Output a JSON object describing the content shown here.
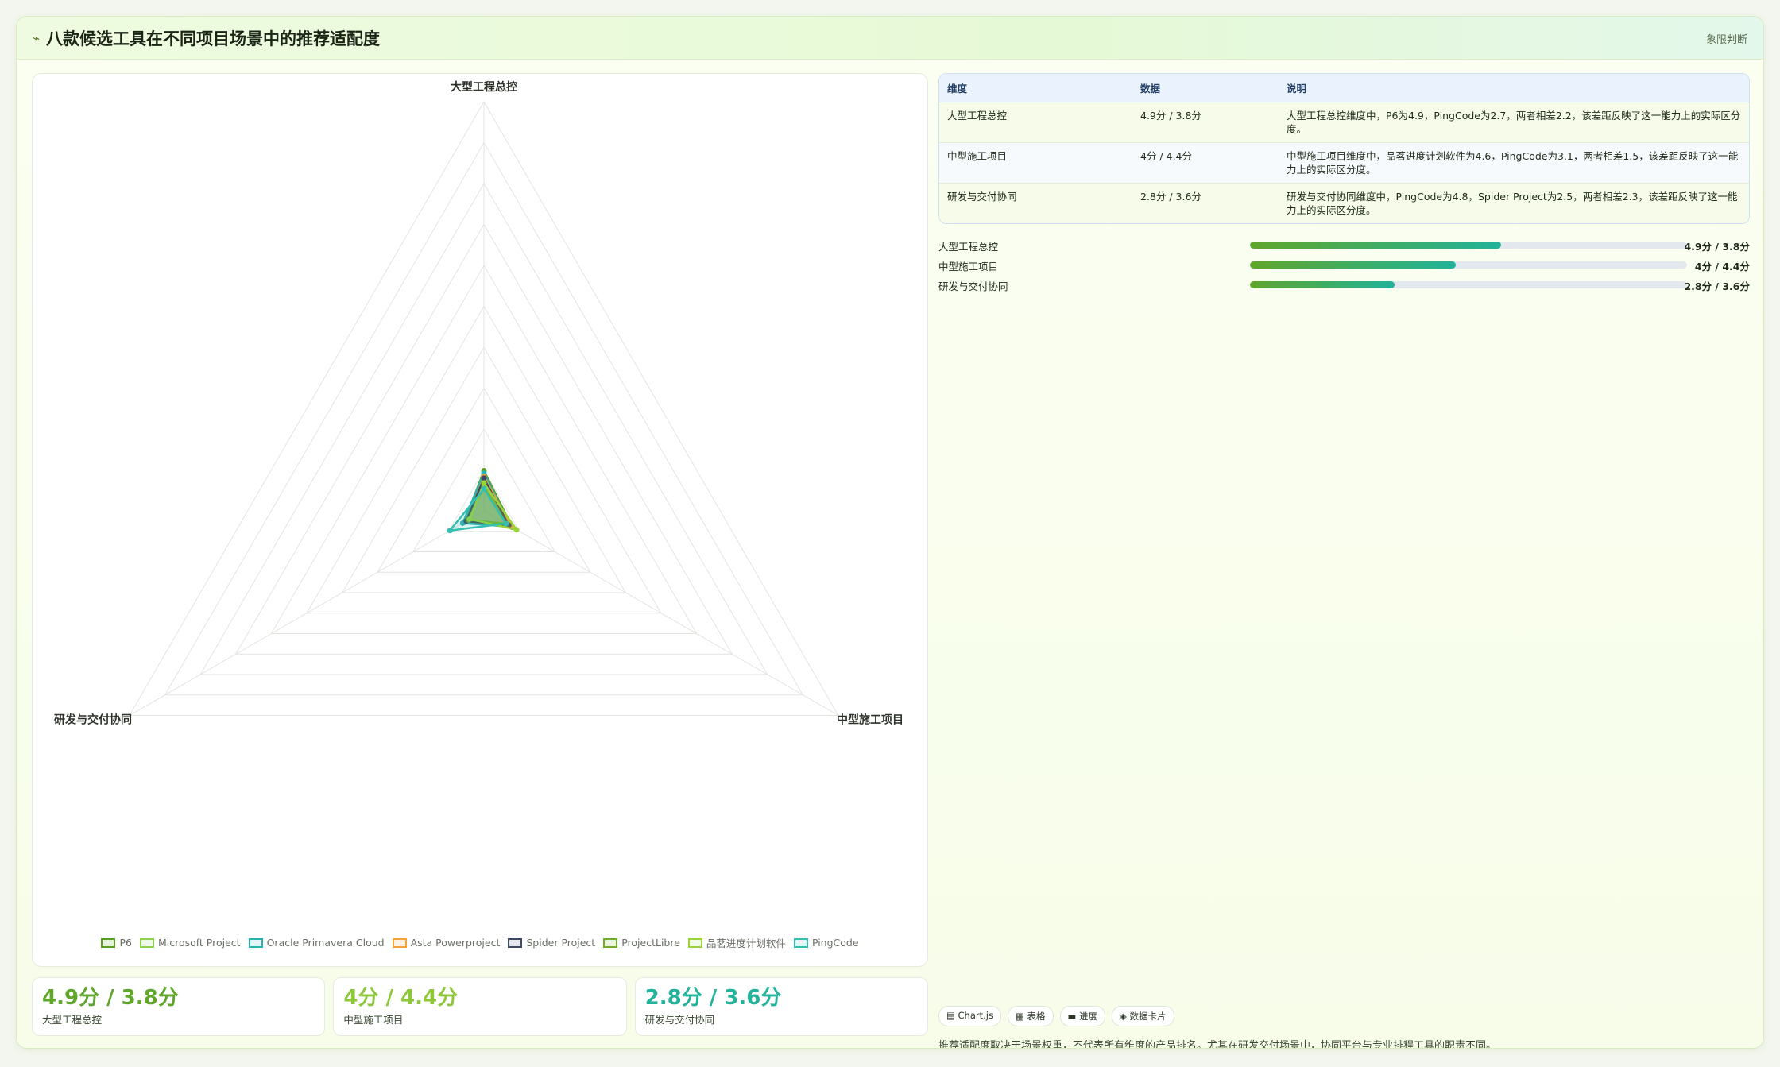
{
  "header": {
    "title": "八款候选工具在不同项目场景中的推荐适配度",
    "tag": "象限判断"
  },
  "chart_data": {
    "type": "radar",
    "axes": [
      "大型工程总控",
      "中型施工项目",
      "研发与交付协同"
    ],
    "rmax": 50,
    "series": [
      {
        "name": "P6",
        "color": "#5a9e1e",
        "values": [
          4.9,
          4.0,
          2.8
        ]
      },
      {
        "name": "Microsoft Project",
        "color": "#8ed14a",
        "values": [
          3.8,
          3.2,
          2.6
        ]
      },
      {
        "name": "Oracle Primavera Cloud",
        "color": "#2ab3ae",
        "values": [
          4.6,
          3.8,
          3.0
        ]
      },
      {
        "name": "Asta Powerproject",
        "color": "#f2a33a",
        "values": [
          4.2,
          3.9,
          2.4
        ]
      },
      {
        "name": "Spider Project",
        "color": "#3f4a63",
        "values": [
          4.0,
          3.5,
          2.5
        ]
      },
      {
        "name": "ProjectLibre",
        "color": "#6dae2a",
        "values": [
          3.0,
          3.1,
          2.2
        ]
      },
      {
        "name": "品茗进度计划软件",
        "color": "#9ad43a",
        "values": [
          3.4,
          4.6,
          2.0
        ]
      },
      {
        "name": "PingCode",
        "color": "#33c0b2",
        "values": [
          2.7,
          3.1,
          4.8
        ]
      }
    ]
  },
  "table": {
    "headers": [
      "维度",
      "数据",
      "说明"
    ],
    "rows": [
      [
        "大型工程总控",
        "4.9分 / 3.8分",
        "大型工程总控维度中，P6为4.9，PingCode为2.7，两者相差2.2，该差距反映了这一能力上的实际区分度。"
      ],
      [
        "中型施工项目",
        "4分 / 4.4分",
        "中型施工项目维度中，品茗进度计划软件为4.6，PingCode为3.1，两者相差1.5，该差距反映了这一能力上的实际区分度。"
      ],
      [
        "研发与交付协同",
        "2.8分 / 3.6分",
        "研发与交付协同维度中，PingCode为4.8，Spider Project为2.5，两者相差2.3，该差距反映了这一能力上的实际区分度。"
      ]
    ]
  },
  "bars": [
    {
      "label": "大型工程总控",
      "value": "4.9分 / 3.8分",
      "fill": 0.575
    },
    {
      "label": "中型施工项目",
      "value": "4分 / 4.4分",
      "fill": 0.47
    },
    {
      "label": "研发与交付协同",
      "value": "2.8分 / 3.6分",
      "fill": 0.33
    }
  ],
  "kpis": [
    {
      "value": "4.9分 / 3.8分",
      "label": "大型工程总控",
      "color": "#5fa62a"
    },
    {
      "value": "4分 / 4.4分",
      "label": "中型施工项目",
      "color": "#8ec73a"
    },
    {
      "value": "2.8分 / 3.6分",
      "label": "研发与交付协同",
      "color": "#22b39a"
    }
  ],
  "chips": [
    "▤ Chart.js",
    "▦ 表格",
    "▬ 进度",
    "◈ 数据卡片"
  ],
  "footnote": "推荐适配度取决于场景权重，不代表所有维度的产品排名。尤其在研发交付场景中，协同平台与专业排程工具的职责不同。"
}
